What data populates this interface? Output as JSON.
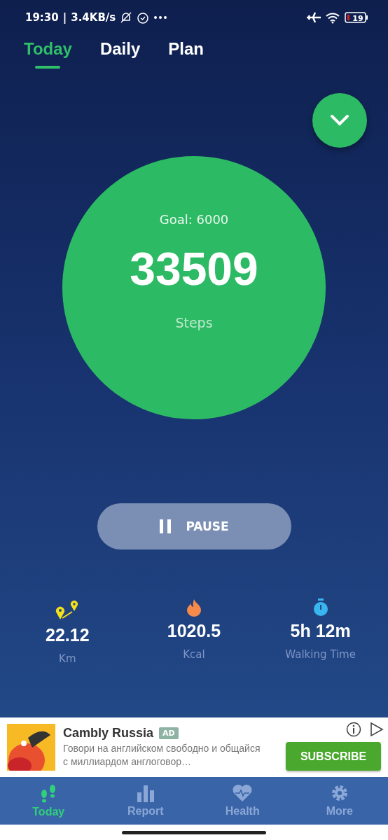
{
  "status_bar": {
    "time": "19:30",
    "divider": "|",
    "speed": "3.4KB/s",
    "battery": "19"
  },
  "tabs": [
    {
      "label": "Today",
      "selected": true
    },
    {
      "label": "Daily",
      "selected": false
    },
    {
      "label": "Plan",
      "selected": false
    }
  ],
  "counter": {
    "goal": "Goal: 6000",
    "steps": "33509",
    "unit": "Steps"
  },
  "pause_button": {
    "label": "PAUSE"
  },
  "stats": [
    {
      "kind": "distance",
      "value": "22.12",
      "unit": "Km"
    },
    {
      "kind": "calories",
      "value": "1020.5",
      "unit": "Kcal"
    },
    {
      "kind": "time",
      "value": "5h 12m",
      "unit": "Walking Time"
    }
  ],
  "ad": {
    "title": "Cambly Russia",
    "badge": "AD",
    "text": "Говори на английском свободно и общайся с миллиардом англоговор…",
    "button": "SUBSCRIBE"
  },
  "bottom_nav": [
    {
      "kind": "today",
      "label": "Today",
      "selected": true
    },
    {
      "kind": "report",
      "label": "Report",
      "selected": false
    },
    {
      "kind": "health",
      "label": "Health",
      "selected": false
    },
    {
      "kind": "more",
      "label": "More",
      "selected": false
    }
  ]
}
